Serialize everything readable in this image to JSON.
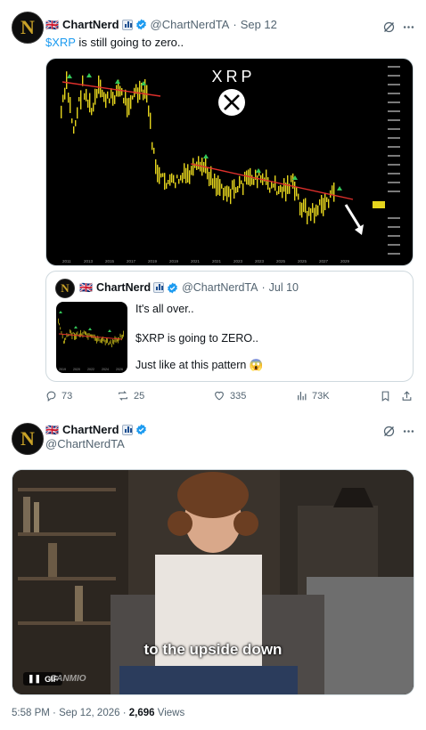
{
  "main_tweet": {
    "flag": "🇬🇧",
    "author": "ChartNerd",
    "handle": "@ChartNerdTA",
    "separator": "·",
    "date": "Sep 12",
    "cashtag": "$XRP",
    "text_rest": " is still going to zero..",
    "chart_image": {
      "title": "XRP",
      "x_ticks": [
        "2011",
        "2013",
        "2015",
        "2017",
        "2019",
        "2019",
        "2021",
        "2021",
        "2023",
        "2023",
        "2025",
        "2025",
        "2027",
        "2029"
      ],
      "icon": "xrp-logo-icon",
      "colors": {
        "candles": "#e6d51d",
        "trendline": "#e0302c",
        "arrows": "#34c759"
      }
    },
    "quoted": {
      "flag": "🇬🇧",
      "author": "ChartNerd",
      "handle": "@ChartNerdTA",
      "separator": "·",
      "date": "Jul 10",
      "line1": "It's all over..",
      "line2": "$XRP is going to ZERO..",
      "line3": "Just like at this pattern 😱",
      "thumb_x_ticks": [
        "2019",
        "2020",
        "2022",
        "2024",
        "2026"
      ]
    },
    "actions": {
      "replies": "73",
      "reposts": "25",
      "likes": "335",
      "views": "73K"
    }
  },
  "reply_tweet": {
    "flag": "🇬🇧",
    "author": "ChartNerd",
    "handle": "@ChartNerdTA",
    "gif": {
      "caption": "to the upside down",
      "badge": "GIF",
      "watermark": "CANMIO"
    }
  },
  "footer": {
    "time": "5:58 PM",
    "separator": "·",
    "date": "Sep 12, 2026",
    "separator2": "·",
    "views_count": "2,696",
    "views_label": " Views"
  }
}
